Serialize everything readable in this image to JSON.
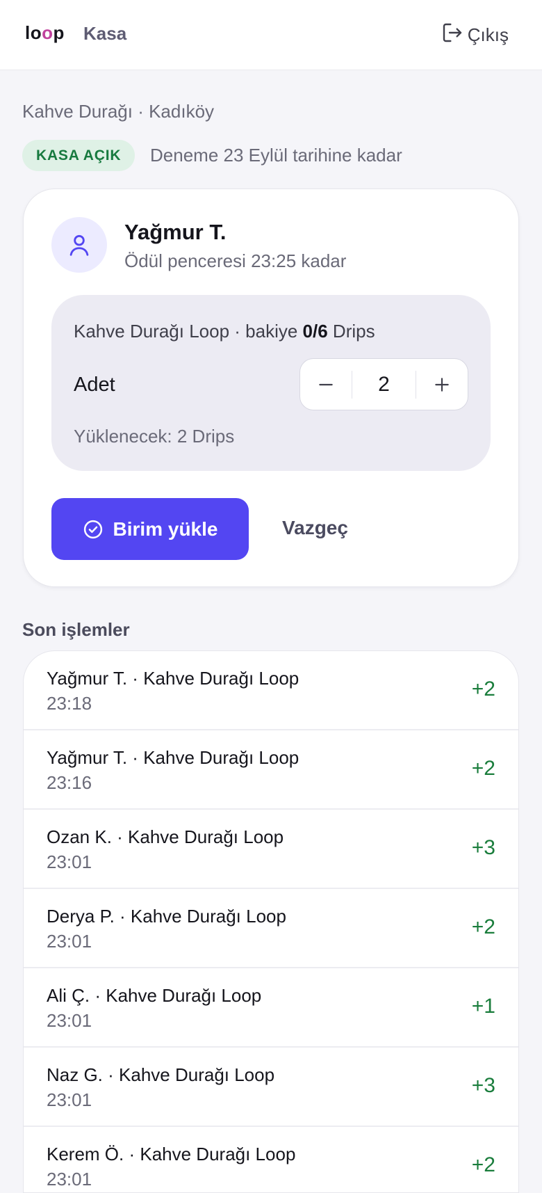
{
  "header": {
    "logo": "loop",
    "title": "Kasa",
    "logout_label": "Çıkış"
  },
  "store": {
    "line": "Kahve Durağı · Kadıköy",
    "status_badge": "KASA AÇIK",
    "trial_text": "Deneme 23 Eylül tarihine kadar"
  },
  "customer": {
    "name": "Yağmur T.",
    "reward_window": "Ödül penceresi 23:25 kadar",
    "balance_prefix": "Kahve Durağı Loop · bakiye ",
    "balance_value": "0/6",
    "balance_suffix": " Drips",
    "quantity_label": "Adet",
    "quantity": "2",
    "to_load": "Yüklenecek: 2 Drips",
    "load_button": "Birim yükle",
    "cancel_button": "Vazgeç"
  },
  "transactions": {
    "title": "Son işlemler",
    "items": [
      {
        "title": "Yağmur T. · Kahve Durağı Loop",
        "time": "23:18",
        "amount": "+2"
      },
      {
        "title": "Yağmur T. · Kahve Durağı Loop",
        "time": "23:16",
        "amount": "+2"
      },
      {
        "title": "Ozan K. · Kahve Durağı Loop",
        "time": "23:01",
        "amount": "+3"
      },
      {
        "title": "Derya P. · Kahve Durağı Loop",
        "time": "23:01",
        "amount": "+2"
      },
      {
        "title": "Ali Ç. · Kahve Durağı Loop",
        "time": "23:01",
        "amount": "+1"
      },
      {
        "title": "Naz G. · Kahve Durağı Loop",
        "time": "23:01",
        "amount": "+3"
      },
      {
        "title": "Kerem Ö. · Kahve Durağı Loop",
        "time": "23:01",
        "amount": "+2"
      }
    ]
  },
  "colors": {
    "primary": "#5346f2",
    "badge_bg": "#dff1e6",
    "badge_text": "#177a3f",
    "positive": "#1a7d3c"
  }
}
